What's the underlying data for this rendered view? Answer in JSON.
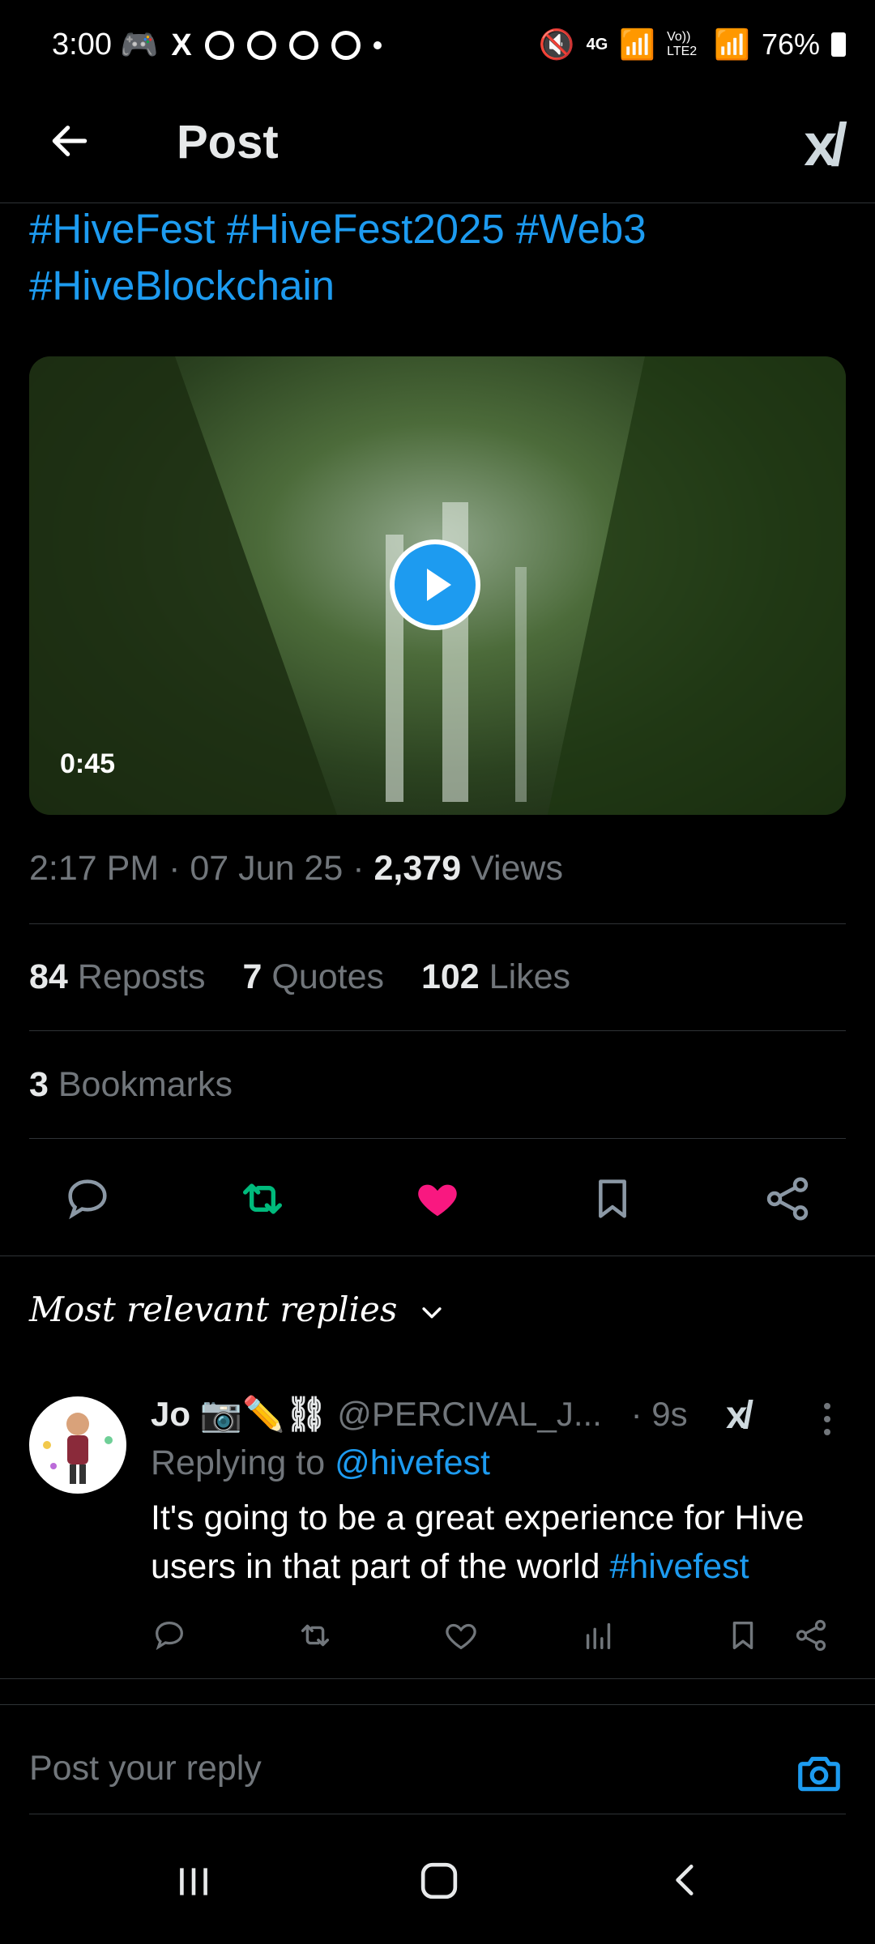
{
  "status_bar": {
    "time": "3:00",
    "network": "4G",
    "volte": "Vo)) LTE2",
    "battery": "76%"
  },
  "header": {
    "title": "Post"
  },
  "post": {
    "hashtags_line1": "#HiveFest #HiveFest2025 #Web3",
    "hashtags_line2": "#HiveBlockchain",
    "video_duration": "0:45",
    "time": "2:17 PM",
    "date": "07 Jun 25",
    "views_count": "2,379",
    "views_label": "Views",
    "reposts_count": "84",
    "reposts_label": "Reposts",
    "quotes_count": "7",
    "quotes_label": "Quotes",
    "likes_count": "102",
    "likes_label": "Likes",
    "bookmarks_count": "3",
    "bookmarks_label": "Bookmarks"
  },
  "replies": {
    "sort_label": "Most relevant replies",
    "items": [
      {
        "name": "Jo 📷✏️⛓",
        "handle": "@PERCIVAL_J...",
        "time": "· 9s",
        "replying_label": "Replying to",
        "replying_to": "@hivefest",
        "text": "It's going to be a great experience for Hive users in that part of the world",
        "text_tag": "#hivefest"
      }
    ]
  },
  "composer": {
    "placeholder": "Post your reply"
  },
  "colors": {
    "accent": "#1d9bf0",
    "repost": "#00ba7c",
    "like": "#f91880",
    "muted": "#71767b"
  }
}
